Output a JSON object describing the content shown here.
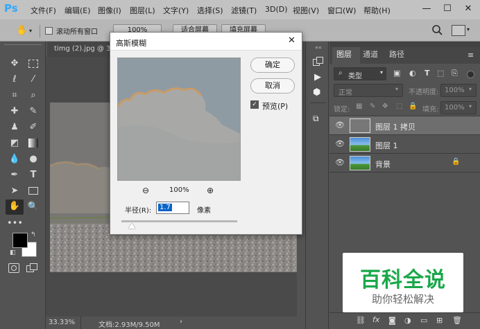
{
  "app": {
    "logo": "Ps"
  },
  "menu": [
    "文件(F)",
    "编辑(E)",
    "图像(I)",
    "图层(L)",
    "文字(Y)",
    "选择(S)",
    "滤镜(T)",
    "3D(D)",
    "视图(V)",
    "窗口(W)",
    "帮助(H)"
  ],
  "window_controls": {
    "minimize": "—",
    "maximize": "☐",
    "close": "✕"
  },
  "options_bar": {
    "scroll_all_windows": "滚动所有窗口",
    "zoom_100": "100%",
    "fit_screen": "适合屏幕",
    "fill_screen": "填充屏幕"
  },
  "document": {
    "tab_title": "timg (2).jpg @ 33",
    "zoom": "33.33%",
    "doc_info": "文档:2.93M/9.50M"
  },
  "dialog": {
    "title": "高斯模糊",
    "ok": "确定",
    "cancel": "取消",
    "preview_label": "预览(P)",
    "preview_checked": true,
    "preview_zoom": "100%",
    "radius_label": "半径(R):",
    "radius_value": "1.7",
    "radius_unit": "像素"
  },
  "layers_panel": {
    "tabs": [
      "图层",
      "通道",
      "路径"
    ],
    "filter_kind": "类型",
    "blend_mode": "正常",
    "opacity_label": "不透明度:",
    "opacity_value": "100%",
    "lock_label": "锁定:",
    "fill_label": "填充:",
    "fill_value": "100%",
    "layers": [
      {
        "name": "图层 1 拷贝",
        "selected": true
      },
      {
        "name": "图层 1",
        "selected": false
      },
      {
        "name": "背景",
        "selected": false,
        "locked": true
      }
    ]
  },
  "watermark": {
    "title": "百科全说",
    "subtitle": "助你轻松解决"
  },
  "colors": {
    "accent": "#31a8ff",
    "selection": "#0a64c8",
    "watermark_green": "#1aa84a"
  }
}
